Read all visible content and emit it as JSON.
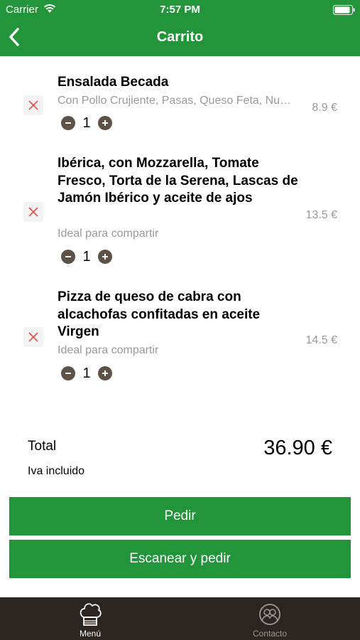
{
  "status_bar": {
    "carrier": "Carrier",
    "time": "7:57 PM"
  },
  "nav": {
    "title": "Carrito",
    "back_icon": "chevron-left-icon"
  },
  "cart_items": [
    {
      "name": "Ensalada Becada",
      "description": "Con Pollo Crujiente, Pasas, Queso Feta, Nueces y Salsa de Mostaza",
      "quantity": "1",
      "price": "8.9 €"
    },
    {
      "name": "Ibérica, con Mozzarella, Tomate Fresco, Torta de la Serena, Lascas de Jamón Ibérico y aceite de ajos",
      "description": "Ideal para compartir",
      "quantity": "1",
      "price": "13.5 €"
    },
    {
      "name": "Pizza de queso de cabra con alcachofas confitadas en aceite Virgen",
      "description": "Ideal para compartir",
      "quantity": "1",
      "price": "14.5 €"
    }
  ],
  "summary": {
    "total_label": "Total",
    "total_value": "36.90 €",
    "vat_note": "Iva incluido"
  },
  "actions": {
    "order_label": "Pedir",
    "scan_order_label": "Escanear y pedir"
  },
  "tab_bar": {
    "menu_label": "Menú",
    "contact_label": "Contacto"
  },
  "colors": {
    "brand_green": "#22943a",
    "tab_bar_bg": "#2b2522",
    "qty_button": "#5e5246",
    "remove_icon": "#e05050"
  }
}
